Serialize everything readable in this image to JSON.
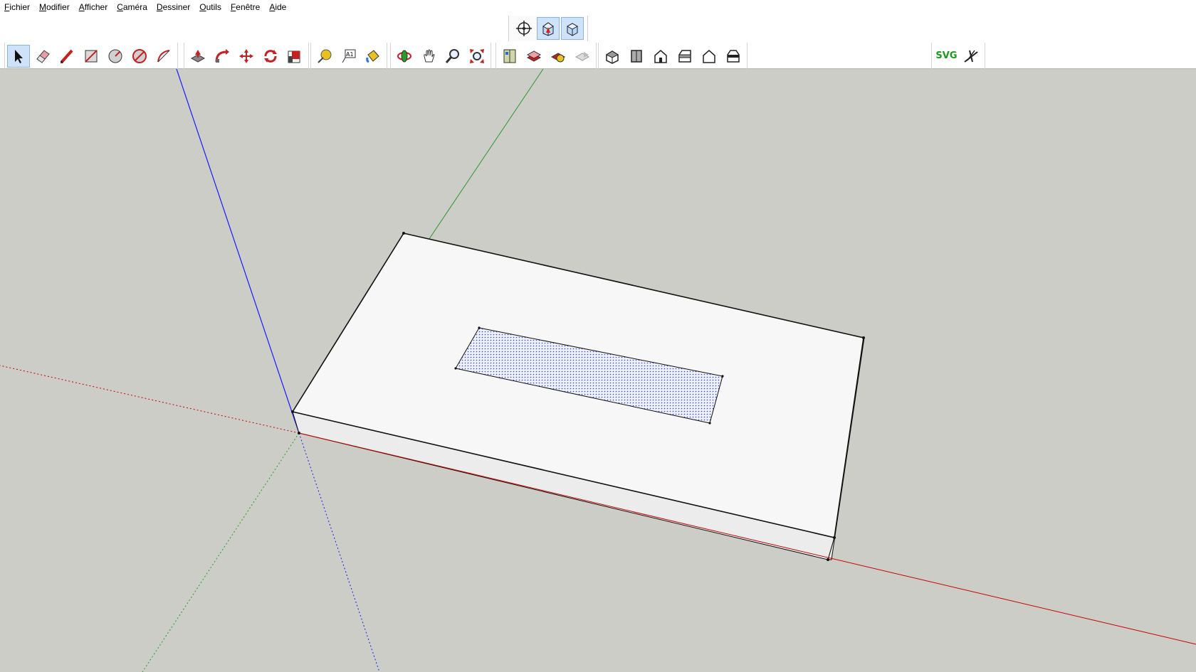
{
  "menu": [
    {
      "label": "Fichier",
      "accel": "F",
      "rest": "ichier"
    },
    {
      "label": "Modifier",
      "accel": "M",
      "rest": "odifier"
    },
    {
      "label": "Afficher",
      "accel": "A",
      "rest": "fficher"
    },
    {
      "label": "Caméra",
      "accel": "C",
      "rest": "améra"
    },
    {
      "label": "Dessiner",
      "accel": "D",
      "rest": "essiner"
    },
    {
      "label": "Outils",
      "accel": "O",
      "rest": "utils"
    },
    {
      "label": "Fenêtre",
      "accel": "F",
      "rest": "enêtre"
    },
    {
      "label": "Aide",
      "accel": "A",
      "rest": "ide"
    }
  ],
  "views_toolbar": [
    "orbit-crosshair-icon",
    "perspective-view-icon",
    "parallel-view-icon"
  ],
  "toolbar": {
    "draw_tools": [
      "select-icon",
      "eraser-icon",
      "pencil-icon",
      "rectangle-icon",
      "circle-icon",
      "polygon-icon",
      "arc-icon"
    ],
    "modify_tools": [
      "push-pull-icon",
      "follow-me-icon",
      "move-icon",
      "rotate-icon",
      "scale-icon"
    ],
    "construct_tools": [
      "tape-measure-icon",
      "text-icon",
      "paint-bucket-icon"
    ],
    "camera_tools": [
      "orbit-icon",
      "pan-icon",
      "zoom-icon",
      "zoom-extents-icon"
    ],
    "warehouse_tools": [
      "components-icon",
      "3d-warehouse-icon",
      "extension-warehouse-icon",
      "share-model-icon"
    ],
    "standard_views": [
      "iso-view-icon",
      "top-view-icon",
      "front-view-icon",
      "right-view-icon",
      "back-view-icon",
      "left-view-icon"
    ],
    "svg_plugin_label": "SVG",
    "active_tool": "select-icon"
  },
  "colors": {
    "viewport_bg": "#cccdc7",
    "axis_red": "#cc0000",
    "axis_green": "#2a9a2a",
    "axis_blue": "#1a1aff",
    "face_top": "#f7f7f7",
    "face_side": "#ececec",
    "selection_blue": "#3344cc",
    "svg_label": "#1a9a1a"
  }
}
